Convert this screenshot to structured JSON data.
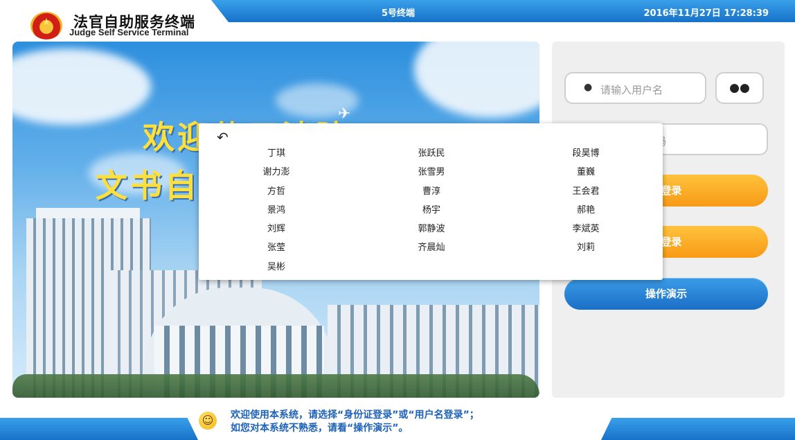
{
  "header": {
    "app_title_cn": "法官自助服务终端",
    "app_title_en": "Judge Self Service Terminal",
    "terminal_label": "5号终端",
    "datetime": "2016年11月27日 17:28:39",
    "emblem_icon": "court-emblem-icon"
  },
  "hero": {
    "line1": "欢迎使用法院",
    "line2": "文书自助"
  },
  "login": {
    "username_placeholder": "请输入用户名",
    "password_placeholder": "码",
    "btn_username_login": "名登录",
    "btn_id_login": "证登录",
    "btn_demo": "操作演示",
    "icons": {
      "user": "user-icon",
      "group": "group-icon"
    },
    "colors": {
      "orange": "#f79a16",
      "blue": "#1a6fc6"
    }
  },
  "popup": {
    "back_icon": "back-arrow-icon",
    "names": [
      [
        "丁琪",
        "张跃民",
        "段昊博"
      ],
      [
        "谢力澎",
        "张雪男",
        "董巍"
      ],
      [
        "方哲",
        "曹淳",
        "王会君"
      ],
      [
        "景鸿",
        "杨宇",
        "郝艳"
      ],
      [
        "刘辉",
        "郭静波",
        "李斌英"
      ],
      [
        "张莹",
        "齐晨灿",
        "刘莉"
      ],
      [
        "吴彬"
      ]
    ]
  },
  "footer": {
    "notice_line1": "欢迎使用本系统，请选择“身份证登录”或“用户名登录”；",
    "notice_line2": "如您对本系统不熟悉，请看“操作演示”。",
    "smiley_icon": "smiley-icon"
  },
  "theme": {
    "bar_blue": "#1672c9",
    "notice_text": "#1d62b8"
  }
}
